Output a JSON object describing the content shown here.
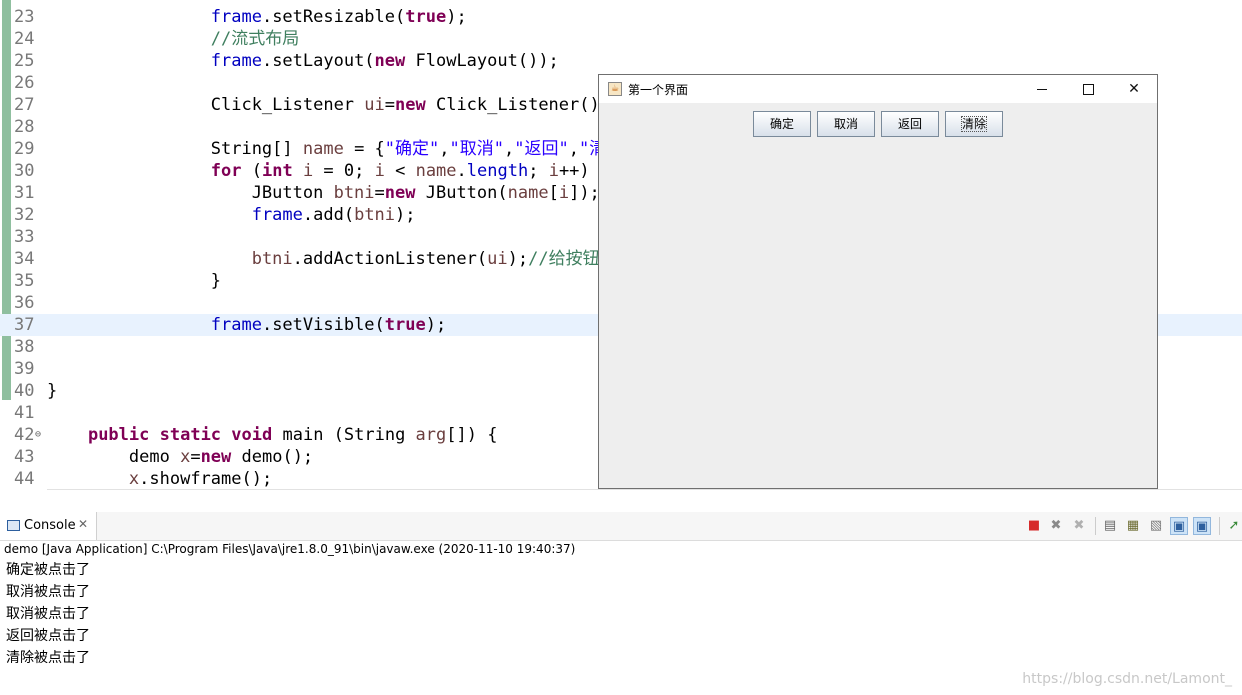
{
  "editor": {
    "lines": [
      {
        "num": "23",
        "segments": [
          {
            "t": "                ",
            "c": ""
          },
          {
            "t": "frame",
            "c": "fd"
          },
          {
            "t": ".setResizable(",
            "c": ""
          },
          {
            "t": "true",
            "c": "kw"
          },
          {
            "t": ");",
            "c": ""
          }
        ]
      },
      {
        "num": "24",
        "segments": [
          {
            "t": "                ",
            "c": ""
          },
          {
            "t": "//流式布局",
            "c": "cm"
          }
        ]
      },
      {
        "num": "25",
        "segments": [
          {
            "t": "                ",
            "c": ""
          },
          {
            "t": "frame",
            "c": "fd"
          },
          {
            "t": ".setLayout(",
            "c": ""
          },
          {
            "t": "new",
            "c": "kw"
          },
          {
            "t": " FlowLayout());",
            "c": ""
          }
        ]
      },
      {
        "num": "26",
        "segments": []
      },
      {
        "num": "27",
        "segments": [
          {
            "t": "                Click_Listener ",
            "c": ""
          },
          {
            "t": "ui",
            "c": "vr"
          },
          {
            "t": "=",
            "c": ""
          },
          {
            "t": "new",
            "c": "kw"
          },
          {
            "t": " Click_Listener();",
            "c": ""
          }
        ]
      },
      {
        "num": "28",
        "segments": []
      },
      {
        "num": "29",
        "segments": [
          {
            "t": "                String[] ",
            "c": ""
          },
          {
            "t": "name",
            "c": "vr"
          },
          {
            "t": " = {",
            "c": ""
          },
          {
            "t": "\"确定\"",
            "c": "st"
          },
          {
            "t": ",",
            "c": ""
          },
          {
            "t": "\"取消\"",
            "c": "st"
          },
          {
            "t": ",",
            "c": ""
          },
          {
            "t": "\"返回\"",
            "c": "st"
          },
          {
            "t": ",",
            "c": ""
          },
          {
            "t": "\"清除\"",
            "c": "st"
          },
          {
            "t": "};",
            "c": ""
          }
        ]
      },
      {
        "num": "30",
        "segments": [
          {
            "t": "                ",
            "c": ""
          },
          {
            "t": "for",
            "c": "kw"
          },
          {
            "t": " (",
            "c": ""
          },
          {
            "t": "int",
            "c": "kw"
          },
          {
            "t": " ",
            "c": ""
          },
          {
            "t": "i",
            "c": "vr"
          },
          {
            "t": " = 0; ",
            "c": ""
          },
          {
            "t": "i",
            "c": "vr"
          },
          {
            "t": " < ",
            "c": ""
          },
          {
            "t": "name",
            "c": "vr"
          },
          {
            "t": ".",
            "c": ""
          },
          {
            "t": "length",
            "c": "fd"
          },
          {
            "t": "; ",
            "c": ""
          },
          {
            "t": "i",
            "c": "vr"
          },
          {
            "t": "++) {",
            "c": ""
          }
        ]
      },
      {
        "num": "31",
        "segments": [
          {
            "t": "                    JButton ",
            "c": ""
          },
          {
            "t": "btni",
            "c": "vr"
          },
          {
            "t": "=",
            "c": ""
          },
          {
            "t": "new",
            "c": "kw"
          },
          {
            "t": " JButton(",
            "c": ""
          },
          {
            "t": "name",
            "c": "vr"
          },
          {
            "t": "[",
            "c": ""
          },
          {
            "t": "i",
            "c": "vr"
          },
          {
            "t": "]);",
            "c": ""
          }
        ]
      },
      {
        "num": "32",
        "segments": [
          {
            "t": "                    ",
            "c": ""
          },
          {
            "t": "frame",
            "c": "fd"
          },
          {
            "t": ".add(",
            "c": ""
          },
          {
            "t": "btni",
            "c": "vr"
          },
          {
            "t": ");",
            "c": ""
          }
        ]
      },
      {
        "num": "33",
        "segments": []
      },
      {
        "num": "34",
        "segments": [
          {
            "t": "                    ",
            "c": ""
          },
          {
            "t": "btni",
            "c": "vr"
          },
          {
            "t": ".addActionListener(",
            "c": ""
          },
          {
            "t": "ui",
            "c": "vr"
          },
          {
            "t": ");",
            "c": ""
          },
          {
            "t": "//给按钮添",
            "c": "cm"
          }
        ]
      },
      {
        "num": "35",
        "segments": [
          {
            "t": "                }",
            "c": ""
          }
        ]
      },
      {
        "num": "36",
        "segments": []
      },
      {
        "num": "37",
        "segments": [
          {
            "t": "                ",
            "c": ""
          },
          {
            "t": "frame",
            "c": "fd"
          },
          {
            "t": ".setVisible(",
            "c": ""
          },
          {
            "t": "true",
            "c": "kw"
          },
          {
            "t": ");",
            "c": ""
          }
        ],
        "current": true
      },
      {
        "num": "38",
        "segments": []
      },
      {
        "num": "39",
        "segments": []
      },
      {
        "num": "40",
        "segments": [
          {
            "t": "}",
            "c": ""
          }
        ]
      },
      {
        "num": "41",
        "segments": []
      },
      {
        "num": "42",
        "segments": [
          {
            "t": "    ",
            "c": ""
          },
          {
            "t": "public",
            "c": "kw"
          },
          {
            "t": " ",
            "c": ""
          },
          {
            "t": "static",
            "c": "kw"
          },
          {
            "t": " ",
            "c": ""
          },
          {
            "t": "void",
            "c": "kw"
          },
          {
            "t": " main (String ",
            "c": ""
          },
          {
            "t": "arg",
            "c": "vr"
          },
          {
            "t": "[]) {",
            "c": ""
          }
        ],
        "fold": "⊖"
      },
      {
        "num": "43",
        "segments": [
          {
            "t": "        demo ",
            "c": ""
          },
          {
            "t": "x",
            "c": "vr"
          },
          {
            "t": "=",
            "c": ""
          },
          {
            "t": "new",
            "c": "kw"
          },
          {
            "t": " demo();",
            "c": ""
          }
        ]
      },
      {
        "num": "44",
        "segments": [
          {
            "t": "        ",
            "c": ""
          },
          {
            "t": "x",
            "c": "vr"
          },
          {
            "t": ".showframe();",
            "c": ""
          }
        ]
      }
    ],
    "scroll_arrow": "<"
  },
  "swing_window": {
    "title": "第一个界面",
    "buttons": [
      "确定",
      "取消",
      "返回",
      "清除"
    ],
    "close_glyph": "✕"
  },
  "console": {
    "tab_label": "Console",
    "tab_close": "✕",
    "launch_info": "demo [Java Application] C:\\Program Files\\Java\\jre1.8.0_91\\bin\\javaw.exe  (2020-11-10 19:40:37)",
    "output": [
      "确定被点击了",
      "取消被点击了",
      "取消被点击了",
      "返回被点击了",
      "清除被点击了"
    ],
    "toolbar": [
      {
        "name": "terminate-icon",
        "glyph": "■",
        "color": "#d62b2b"
      },
      {
        "name": "remove-launch-icon",
        "glyph": "✖",
        "color": "#8a8a8a"
      },
      {
        "name": "remove-all-terminated-icon",
        "glyph": "✖",
        "color": "#b0b0b0"
      },
      {
        "name": "clear-console-icon",
        "glyph": "▤",
        "color": "#666666"
      },
      {
        "name": "scroll-lock-icon",
        "glyph": "▦",
        "color": "#6b6b30"
      },
      {
        "name": "word-wrap-icon",
        "glyph": "▧",
        "color": "#7a7a7a"
      },
      {
        "name": "show-on-stdout-icon",
        "glyph": "▣",
        "color": "#2d5f9e",
        "active": true
      },
      {
        "name": "show-on-stderr-icon",
        "glyph": "▣",
        "color": "#2d5f9e",
        "active": true
      },
      {
        "name": "pin-console-icon",
        "glyph": "➚",
        "color": "#3a8a3a"
      }
    ]
  },
  "watermark": "https://blog.csdn.net/Lamont_"
}
